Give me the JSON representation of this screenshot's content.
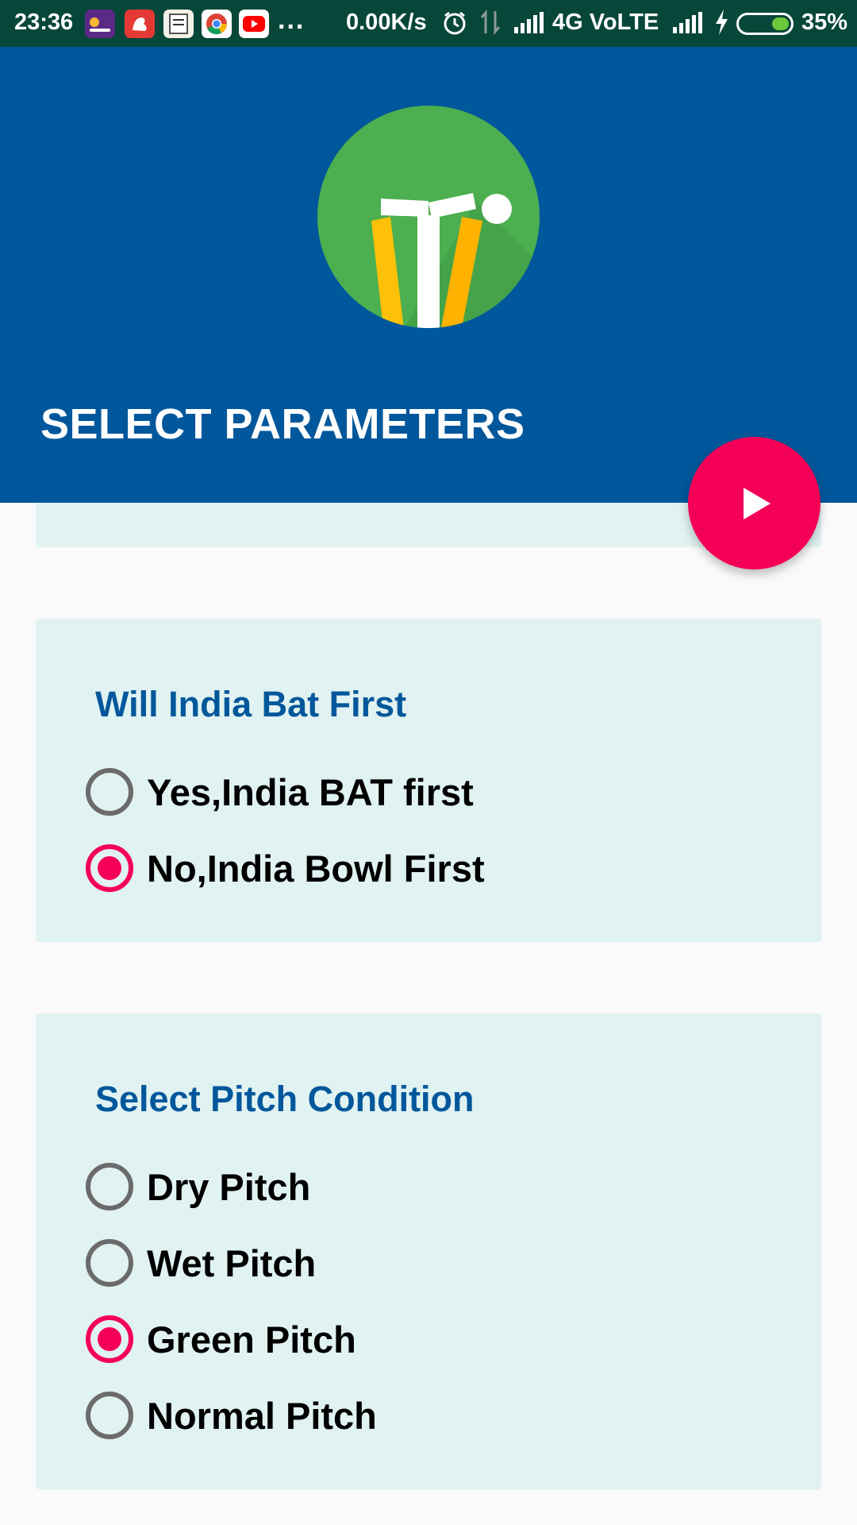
{
  "status_bar": {
    "time": "23:36",
    "overflow": "...",
    "net_speed": "0.00K/s",
    "network": "4G VoLTE",
    "battery_percent": "35%",
    "battery_level": 0.35,
    "icons": [
      "josh-app-icon",
      "strength-app-icon",
      "notes-app-icon",
      "chrome-icon",
      "youtube-icon",
      "alarm-icon",
      "data-sync-icon",
      "signal-icon",
      "charging-icon",
      "battery-icon"
    ]
  },
  "header": {
    "title": "SELECT PARAMETERS",
    "logo_icon": "cricket-wicket-logo-icon"
  },
  "fab": {
    "icon": "play-icon",
    "color": "#f50057"
  },
  "colors": {
    "primary": "#01579b",
    "accent": "#f50057",
    "card_background": "#e0f2f1"
  },
  "bat_first": {
    "title": "Will India Bat First",
    "options": [
      {
        "label": "Yes,India BAT first",
        "checked": false
      },
      {
        "label": "No,India Bowl First",
        "checked": true
      }
    ]
  },
  "pitch": {
    "title": "Select Pitch Condition",
    "options": [
      {
        "label": "Dry Pitch",
        "checked": false
      },
      {
        "label": "Wet Pitch",
        "checked": false
      },
      {
        "label": "Green Pitch",
        "checked": true
      },
      {
        "label": "Normal Pitch",
        "checked": false
      }
    ]
  }
}
